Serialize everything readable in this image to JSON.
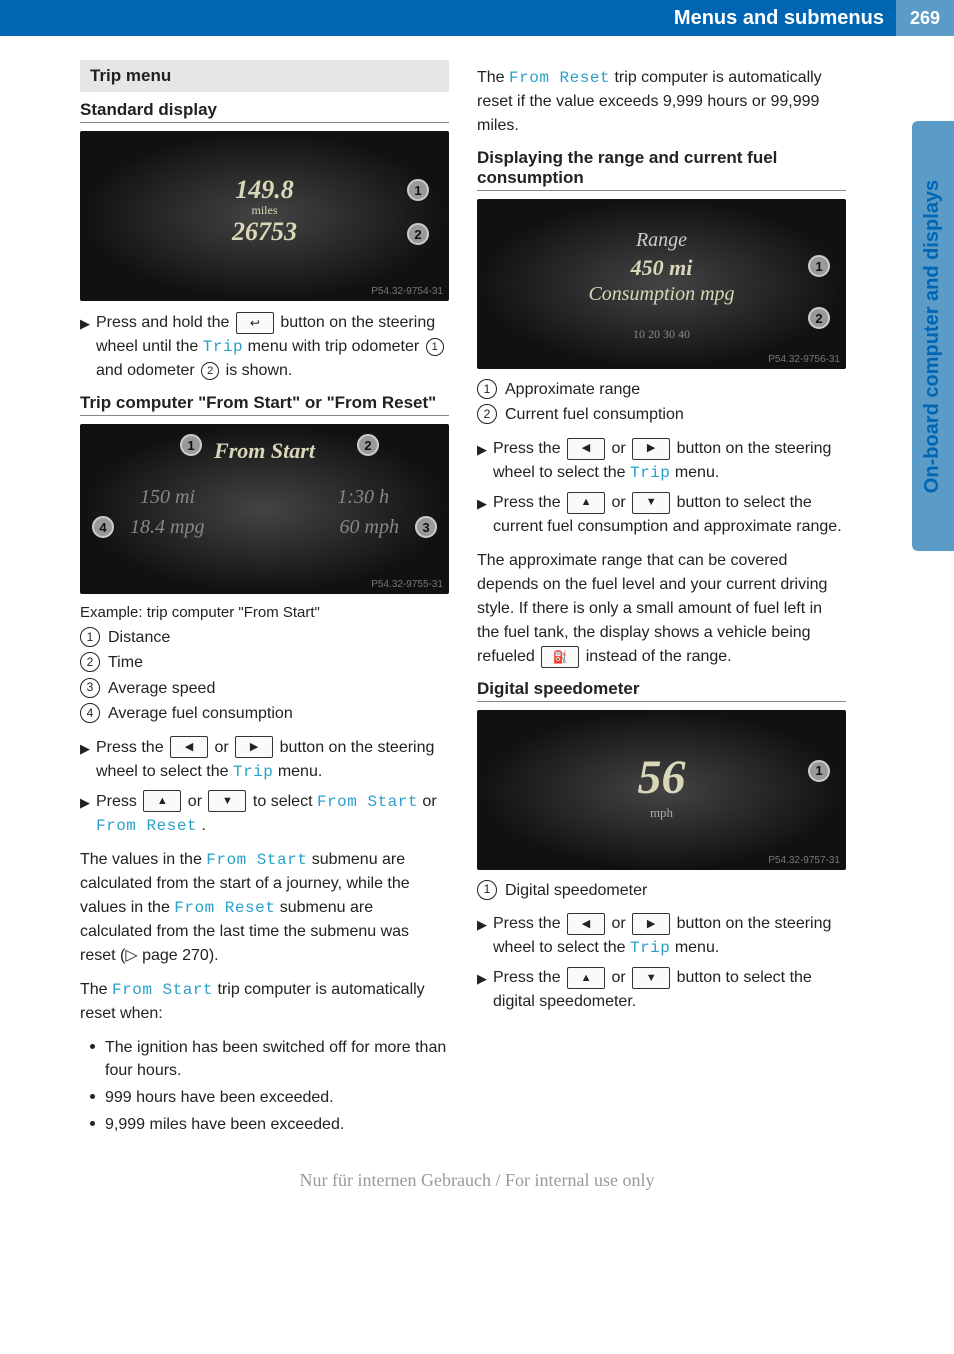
{
  "header": {
    "title": "Menus and submenus",
    "page_number": "269"
  },
  "side_tab": "On-board computer and displays",
  "left": {
    "section_bar": "Trip menu",
    "sub1": "Standard display",
    "img1": {
      "value1": "149.8",
      "unit1": "miles",
      "value2": "26753",
      "tag": "P54.32-9754-31"
    },
    "step1_a": "Press and hold the ",
    "step1_b": " button on the steering wheel until the ",
    "step1_trip": "Trip",
    "step1_c": " menu with trip odometer ",
    "step1_d": " and odometer ",
    "step1_e": " is shown.",
    "back_key": "↩",
    "sub2": "Trip computer \"From Start\" or \"From Reset\"",
    "img2": {
      "label": "From Start",
      "dist": "150 mi",
      "time": "1:30 h",
      "mpg": "18.4 mpg",
      "mph": "60 mph",
      "tag": "P54.32-9755-31"
    },
    "caption2": "Example: trip computer \"From Start\"",
    "enum2": [
      "Distance",
      "Time",
      "Average speed",
      "Average fuel consumption"
    ],
    "step2a_a": "Press the ",
    "step2a_b": " or ",
    "step2a_c": " button on the steering wheel to select the ",
    "step2a_trip": "Trip",
    "step2a_d": " menu.",
    "step2b_a": "Press ",
    "step2b_b": " or ",
    "step2b_c": " to select ",
    "step2b_fs": "From Start",
    "step2b_d": " or ",
    "step2b_fr": "From Reset",
    "step2b_e": ".",
    "para2a_a": "The values in the ",
    "para2a_fs": "From Start",
    "para2a_b": " submenu are calculated from the start of a journey, while the values in the ",
    "para2a_fr": "From Reset",
    "para2a_c": " submenu are calculated from the last time the submenu was reset (▷ page 270).",
    "para2b_a": "The ",
    "para2b_fs": "From Start",
    "para2b_b": " trip computer is automatically reset when:",
    "bullets": [
      "The ignition has been switched off for more than four hours.",
      "999 hours have been exceeded.",
      "9,999 miles have been exceeded."
    ]
  },
  "right": {
    "para1_a": "The ",
    "para1_fr": "From Reset",
    "para1_b": " trip computer is automatically reset if the value exceeds 9,999 hours or 99,999 miles.",
    "sub1": "Displaying the range and current fuel consumption",
    "img1": {
      "l1": "Range",
      "l2": "450 mi",
      "l3": "Consumption mpg",
      "ticks": "10     20     30     40",
      "tag": "P54.32-9756-31"
    },
    "enum1": [
      "Approximate range",
      "Current fuel consumption"
    ],
    "step1a_a": "Press the ",
    "step1a_b": " or ",
    "step1a_c": " button on the steering wheel to select the ",
    "step1a_trip": "Trip",
    "step1a_d": " menu.",
    "step1b_a": "Press the ",
    "step1b_b": " or ",
    "step1b_c": " button to select the current fuel consumption and approximate range.",
    "para2": "The approximate range that can be covered depends on the fuel level and your current driving style. If there is only a small amount of fuel left in the fuel tank, the display shows a vehicle being refueled ",
    "para2_end": " instead of the range.",
    "refuel_icon": "⛽",
    "sub2": "Digital speedometer",
    "img2": {
      "speed": "56",
      "unit": "mph",
      "tag": "P54.32-9757-31"
    },
    "enum2": [
      "Digital speedometer"
    ],
    "step2a_a": "Press the ",
    "step2a_b": " or ",
    "step2a_c": " button on the steering wheel to select the ",
    "step2a_trip": "Trip",
    "step2a_d": " menu.",
    "step2b_a": "Press the ",
    "step2b_b": " or ",
    "step2b_c": " button to select the digital speedometer."
  },
  "keys": {
    "left": "◀",
    "right": "▶",
    "up": "▲",
    "down": "▼"
  },
  "watermark": "Nur für internen Gebrauch / For internal use only"
}
